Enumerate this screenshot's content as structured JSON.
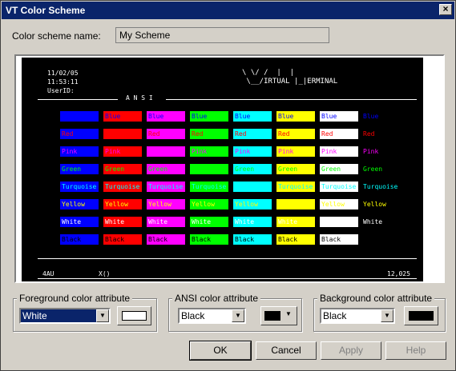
{
  "window": {
    "title": "VT Color Scheme",
    "close": "×"
  },
  "scheme": {
    "label": "Color scheme name:",
    "value": "My Scheme"
  },
  "terminal": {
    "date": "11/02/05",
    "time": "11:53:11",
    "userid": "UserID:",
    "logo": "\\ \\/ /  |  |\n \\__/IRTUAL |_|ERMINAL",
    "ansi": "A N S I",
    "status_left": "4AU",
    "status_mid": "X()",
    "status_right": "12,025"
  },
  "rows": [
    {
      "cells": [
        "",
        "Blue",
        "Blue",
        "Blue",
        "Blue",
        "Blue",
        "Blue"
      ],
      "label": "Blue"
    },
    {
      "cells": [
        "Red",
        "",
        "Red",
        "Red",
        "Red",
        "Red",
        "Red"
      ],
      "label": "Red"
    },
    {
      "cells": [
        "Pink",
        "Pink",
        "",
        "Pink",
        "Pink",
        "Pink",
        "Pink"
      ],
      "label": "Pink"
    },
    {
      "cells": [
        "Green",
        "Green",
        "Green",
        "",
        "Green",
        "Green",
        "Green"
      ],
      "label": "Green"
    },
    {
      "cells": [
        "Turquoise",
        "Turquoise",
        "Turquoise",
        "Turquoise",
        "",
        "Turquoise",
        "Turquoise"
      ],
      "label": "Turquoise"
    },
    {
      "cells": [
        "Yellow",
        "Yellow",
        "Yellow",
        "Yellow",
        "Yellow",
        "",
        "Yellow"
      ],
      "label": "Yellow"
    },
    {
      "cells": [
        "White",
        "White",
        "White",
        "White",
        "White",
        "White",
        ""
      ],
      "label": "White"
    },
    {
      "cells": [
        "Black",
        "Black",
        "Black",
        "Black",
        "Black",
        "Black",
        "Black"
      ],
      "label": ""
    }
  ],
  "colors": {
    "blue": "#0000ff",
    "red": "#ff0000",
    "pink": "#ff00ff",
    "green": "#00ff00",
    "turquoise": "#00ffff",
    "yellow": "#ffff00",
    "white": "#ffffff",
    "black": "#000000"
  },
  "fg": {
    "title": "Foreground color attribute",
    "value": "White"
  },
  "ansi_attr": {
    "title": "ANSI color attribute",
    "value": "Black"
  },
  "bg": {
    "title": "Background color attribute",
    "value": "Black"
  },
  "buttons": {
    "ok": "OK",
    "cancel": "Cancel",
    "apply": "Apply",
    "help": "Help"
  }
}
